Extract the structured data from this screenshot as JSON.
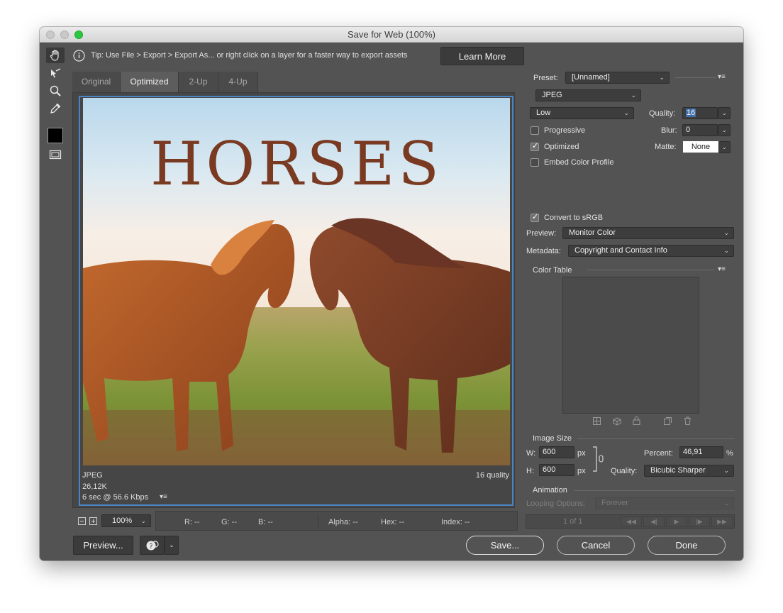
{
  "window": {
    "title": "Save for Web (100%)"
  },
  "tip": {
    "text": "Tip: Use File > Export > Export As...  or right click on a layer for a faster way to export assets",
    "learn_more": "Learn More"
  },
  "tools": [
    "hand-icon",
    "slice-select-icon",
    "zoom-icon",
    "eyedropper-icon",
    "color-swatch",
    "slice-visibility-icon"
  ],
  "tabs": [
    {
      "label": "Original",
      "active": false
    },
    {
      "label": "Optimized",
      "active": true
    },
    {
      "label": "2-Up",
      "active": false
    },
    {
      "label": "4-Up",
      "active": false
    }
  ],
  "image": {
    "title": "HORSES"
  },
  "optimized_info": {
    "format": "JPEG",
    "size": "26,12K",
    "time": "6 sec @ 56.6 Kbps",
    "quality": "16 quality"
  },
  "status": {
    "zoom": "100%",
    "r": "R: --",
    "g": "G: --",
    "b": "B: --",
    "alpha": "Alpha: --",
    "hex": "Hex: --",
    "index": "Index: --"
  },
  "settings": {
    "preset_label": "Preset:",
    "preset_value": "[Unnamed]",
    "format": "JPEG",
    "quality_level": "Low",
    "quality_label": "Quality:",
    "quality_value": "16",
    "progressive_label": "Progressive",
    "progressive": false,
    "blur_label": "Blur:",
    "blur_value": "0",
    "optimized_label": "Optimized",
    "optimized": true,
    "matte_label": "Matte:",
    "matte_value": "None",
    "embed_label": "Embed Color Profile",
    "embed": false,
    "convert_label": "Convert to sRGB",
    "convert": true,
    "preview_label": "Preview:",
    "preview_value": "Monitor Color",
    "metadata_label": "Metadata:",
    "metadata_value": "Copyright and Contact Info",
    "color_table_label": "Color Table"
  },
  "image_size": {
    "label": "Image Size",
    "w_label": "W:",
    "w_value": "600",
    "h_label": "H:",
    "h_value": "600",
    "unit": "px",
    "percent_label": "Percent:",
    "percent_value": "46,91",
    "percent_unit": "%",
    "quality_label": "Quality:",
    "quality_value": "Bicubic Sharper"
  },
  "animation": {
    "label": "Animation",
    "looping_label": "Looping Options:",
    "looping_value": "Forever",
    "frame": "1 of 1"
  },
  "buttons": {
    "preview": "Preview...",
    "save": "Save...",
    "cancel": "Cancel",
    "done": "Done"
  },
  "colors": {
    "accent": "#4a86c5",
    "window_bg": "#535353",
    "title_text": "#7a3a22"
  }
}
